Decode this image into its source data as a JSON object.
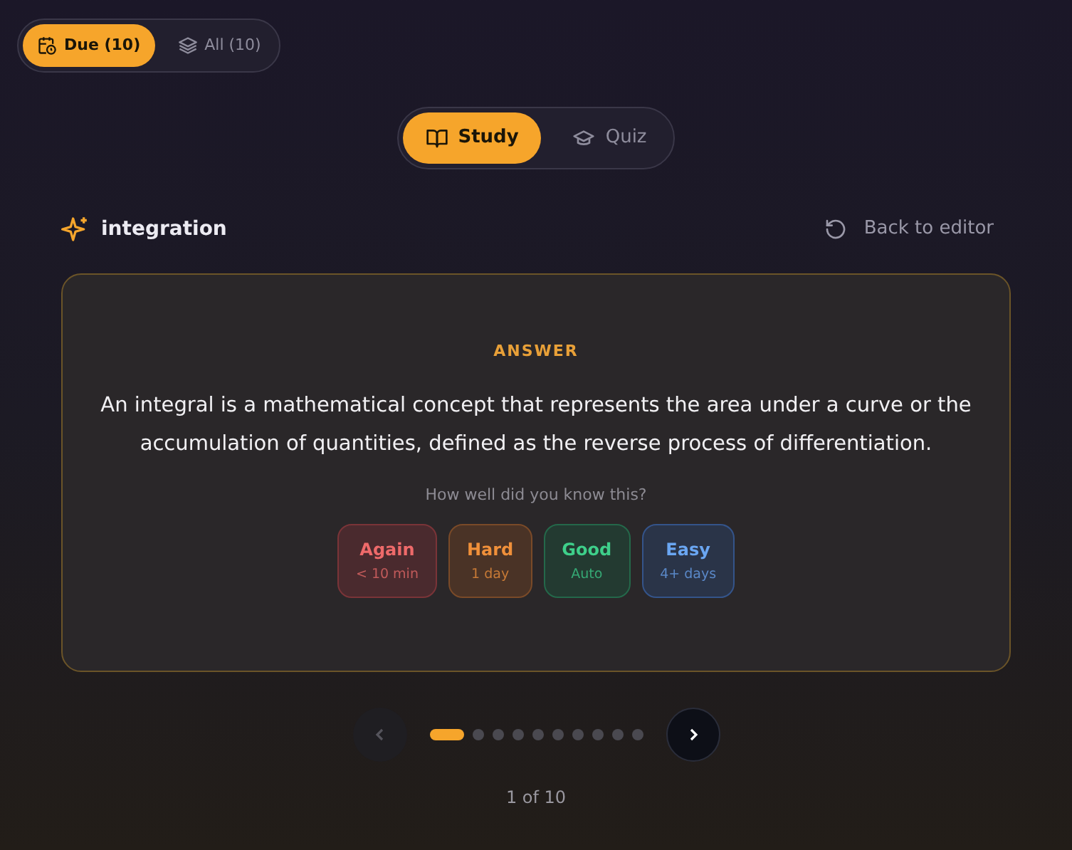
{
  "filters": [
    {
      "label": "Due (10)",
      "selected": true
    },
    {
      "label": "All (10)",
      "selected": false
    }
  ],
  "modes": [
    {
      "label": "Study",
      "selected": true
    },
    {
      "label": "Quiz",
      "selected": false
    }
  ],
  "deck": {
    "title": "integration",
    "back_link": "Back to editor"
  },
  "card": {
    "side_label": "ANSWER",
    "text": "An integral is a mathematical concept that represents the area under a curve or the accumulation of quantities, defined as the reverse process of differentiation.",
    "prompt": "How well did you know this?",
    "ratings": [
      {
        "kind": "again",
        "label": "Again",
        "interval": "< 10 min"
      },
      {
        "kind": "hard",
        "label": "Hard",
        "interval": "1 day"
      },
      {
        "kind": "good",
        "label": "Good",
        "interval": "Auto"
      },
      {
        "kind": "easy",
        "label": "Easy",
        "interval": "4+ days"
      }
    ]
  },
  "pager": {
    "prev_disabled": true,
    "dots": [
      {
        "selected": true
      },
      {
        "selected": false
      },
      {
        "selected": false
      },
      {
        "selected": false
      },
      {
        "selected": false
      },
      {
        "selected": false
      },
      {
        "selected": false
      },
      {
        "selected": false
      },
      {
        "selected": false
      },
      {
        "selected": false
      }
    ],
    "counter": "1 of 10"
  }
}
